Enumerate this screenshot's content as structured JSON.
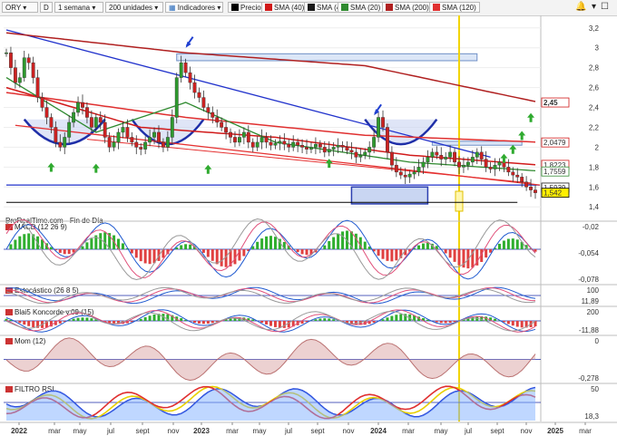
{
  "toolbar": {
    "symbol": "ORY",
    "symbol_sub": "D",
    "period": "1 semana",
    "units": "200 unidades",
    "indicators": "Indicadores",
    "legend": [
      {
        "label": "Precio",
        "color": "#000000"
      },
      {
        "label": "SMA (40)",
        "color": "#d11a1a"
      },
      {
        "label": "SMA (4)",
        "color": "#1a1a1a"
      },
      {
        "label": "SMA (20)",
        "color": "#2f8a2f"
      },
      {
        "label": "SMA (200)",
        "color": "#b02020"
      },
      {
        "label": "SMA (120)",
        "color": "#e03030"
      }
    ]
  },
  "source_label": "ProRealTime.com - Fin de Día",
  "panes": {
    "macd": "MACD (12 26 9)",
    "stoch": "Estocástico (26 8 5)",
    "blai5": "Blai5 Koncorde v.09 (15)",
    "mom": "Mom (12)",
    "rsi": "FILTRO RSI"
  },
  "price_axis": {
    "ticks": [
      "3,2",
      "3",
      "2,8",
      "2,6",
      "2,4",
      "2,2",
      "2",
      "1,8",
      "1,6",
      "1,4"
    ],
    "badges": [
      {
        "text": "2,45",
        "color": "#d11a1a",
        "value": 2.45,
        "bold": true
      },
      {
        "text": "2,0479",
        "color": "#d11a1a",
        "value": 2.0479
      },
      {
        "text": "1,8223",
        "color": "#d11a1a",
        "value": 1.8223
      },
      {
        "text": "1,7559",
        "color": "#2f8a2f",
        "value": 1.7559
      },
      {
        "text": "1,5939",
        "color": "#1a1a1a",
        "value": 1.5939
      },
      {
        "text": "1,542",
        "color": "#000000",
        "value": 1.542,
        "hl": true
      }
    ]
  },
  "indicator_axis": {
    "macd": [
      "-0,02",
      "-0,054",
      "-0,078"
    ],
    "stoch": [
      "100",
      "11,89"
    ],
    "blai5": [
      "200",
      "-11,88"
    ],
    "mom": [
      "0",
      "-0,278"
    ],
    "rsi": [
      "50",
      "18,3"
    ]
  },
  "x_axis": [
    "2022",
    "mar",
    "may",
    "jul",
    "sept",
    "nov",
    "2023",
    "mar",
    "may",
    "jul",
    "sept",
    "nov",
    "2024",
    "mar",
    "may",
    "jul",
    "sept",
    "nov",
    "2025",
    "mar"
  ],
  "chart_data": {
    "type": "candlestick",
    "title": "",
    "period": "weekly",
    "y_range": [
      1.32,
      3.28
    ],
    "series_close": [
      2.95,
      2.8,
      2.65,
      2.7,
      2.9,
      2.85,
      2.7,
      2.5,
      2.4,
      2.3,
      2.2,
      2.05,
      2.0,
      2.1,
      2.25,
      2.35,
      2.45,
      2.4,
      2.3,
      2.2,
      2.3,
      2.25,
      2.1,
      2.0,
      2.05,
      2.15,
      2.2,
      2.1,
      2.05,
      2.0,
      1.98,
      2.05,
      2.1,
      2.15,
      2.05,
      2.0,
      2.1,
      2.3,
      2.7,
      2.85,
      2.75,
      2.65,
      2.55,
      2.5,
      2.4,
      2.35,
      2.3,
      2.25,
      2.2,
      2.15,
      2.1,
      2.05,
      2.1,
      2.15,
      2.05,
      2.0,
      2.05,
      2.1,
      2.05,
      2.02,
      2.04,
      2.06,
      2.03,
      2.0,
      2.05,
      2.02,
      2.0,
      1.98,
      2.0,
      2.03,
      2.0,
      1.95,
      1.98,
      2.0,
      2.02,
      2.0,
      1.97,
      1.95,
      1.9,
      1.92,
      1.95,
      2.0,
      2.1,
      2.3,
      2.2,
      1.95,
      1.82,
      1.75,
      1.72,
      1.7,
      1.73,
      1.75,
      1.8,
      1.85,
      1.9,
      1.95,
      1.92,
      1.88,
      1.9,
      1.95,
      1.85,
      1.8,
      1.82,
      1.85,
      1.9,
      1.95,
      1.88,
      1.8,
      1.78,
      1.82,
      1.85,
      1.8,
      1.75,
      1.72,
      1.7,
      1.65,
      1.6,
      1.57,
      1.542
    ],
    "series_sma": [
      {
        "name": "SMA (200)",
        "color": "#b02020",
        "points": [
          [
            0,
            3.15
          ],
          [
            40,
            2.95
          ],
          [
            80,
            2.82
          ],
          [
            119,
            2.45
          ]
        ]
      },
      {
        "name": "SMA (120)",
        "color": "#e03030",
        "points": [
          [
            0,
            2.55
          ],
          [
            40,
            2.3
          ],
          [
            80,
            2.12
          ],
          [
            119,
            2.05
          ]
        ]
      },
      {
        "name": "SMA (40)",
        "color": "#d11a1a",
        "points": [
          [
            0,
            2.6
          ],
          [
            30,
            2.2
          ],
          [
            60,
            2.1
          ],
          [
            90,
            1.92
          ],
          [
            119,
            1.82
          ]
        ]
      },
      {
        "name": "SMA (20)",
        "color": "#2f8a2f",
        "points": [
          [
            0,
            2.7
          ],
          [
            20,
            2.15
          ],
          [
            40,
            2.45
          ],
          [
            60,
            2.05
          ],
          [
            90,
            1.85
          ],
          [
            119,
            1.76
          ]
        ]
      }
    ],
    "annotations": {
      "resistance_box": {
        "x0": 38,
        "x1": 105,
        "y0": 2.87,
        "y1": 2.94
      },
      "support_box": {
        "x0": 77,
        "x1": 94,
        "y0": 1.43,
        "y1": 1.6
      },
      "small_box": {
        "x0": 95,
        "x1": 115,
        "y0": 2.02,
        "y1": 2.06
      },
      "vertical_marker": 101
    }
  }
}
